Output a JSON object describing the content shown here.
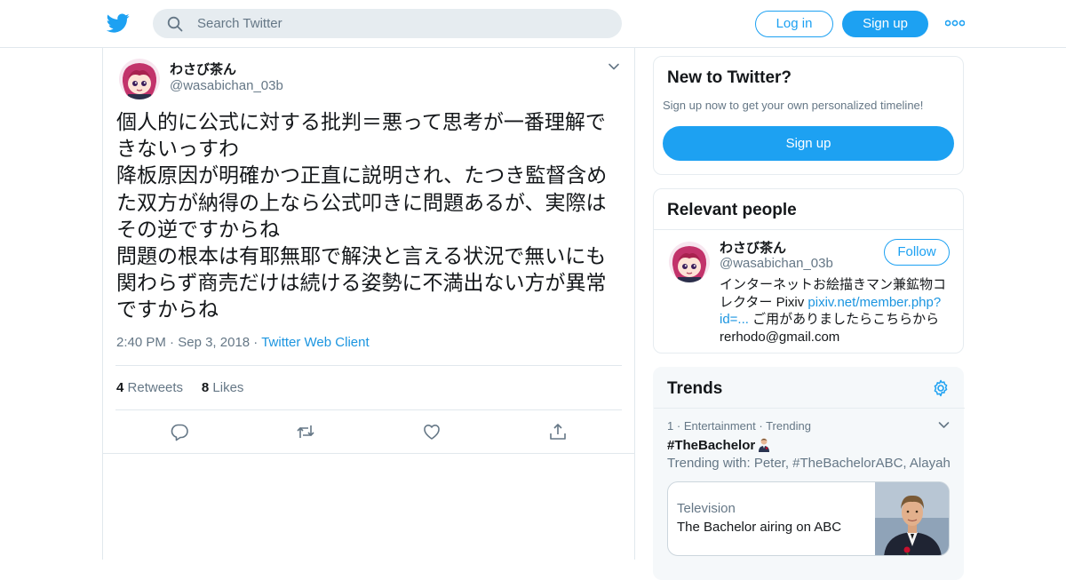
{
  "topbar": {
    "search_placeholder": "Search Twitter",
    "login_label": "Log in",
    "signup_label": "Sign up",
    "brand_color": "#1da1f2"
  },
  "tweet": {
    "display_name": "わさび茶ん",
    "handle": "@wasabichan_03b",
    "text_lines": [
      "個人的に公式に対する批判＝悪って思考が一番理解で",
      "きないっすわ",
      "降板原因が明確かつ正直に説明され、たつき監督含め",
      "た双方が納得の上なら公式叩きに問題あるが、実際は",
      "その逆ですからね",
      "問題の根本は有耶無耶で解決と言える状況で無いにも",
      "関わらず商売だけは続ける姿勢に不満出ない方が異常",
      "ですからね"
    ],
    "time": "2:40 PM",
    "date": "Sep 3, 2018",
    "client": "Twitter Web Client",
    "retweet_count": "4",
    "retweet_label": "Retweets",
    "like_count": "8",
    "like_label": "Likes"
  },
  "sidebar": {
    "new_to_twitter": {
      "title": "New to Twitter?",
      "subtitle": "Sign up now to get your own personalized timeline!",
      "signup_label": "Sign up"
    },
    "relevant_people": {
      "title": "Relevant people",
      "display_name": "わさび茶ん",
      "handle": "@wasabichan_03b",
      "follow_label": "Follow",
      "bio_line1": "インターネットお絵描きマン兼鉱物コ",
      "bio_line2_prefix": "レクター Pixiv ",
      "bio_link_part1": "pixiv.net/member.php?",
      "bio_link_part2": "id=...",
      "bio_line3_suffix": " ご用がありましたらこちらから",
      "bio_line4": "rerhodo@gmail.com"
    },
    "trends": {
      "title": "Trends",
      "rank": "1",
      "category": "Entertainment",
      "status": "Trending",
      "hashtag": "#TheBachelor",
      "trending_with": "Trending with: Peter, #TheBachelorABC, Alayah",
      "card_category": "Television",
      "card_title": "The Bachelor airing on ABC"
    }
  }
}
